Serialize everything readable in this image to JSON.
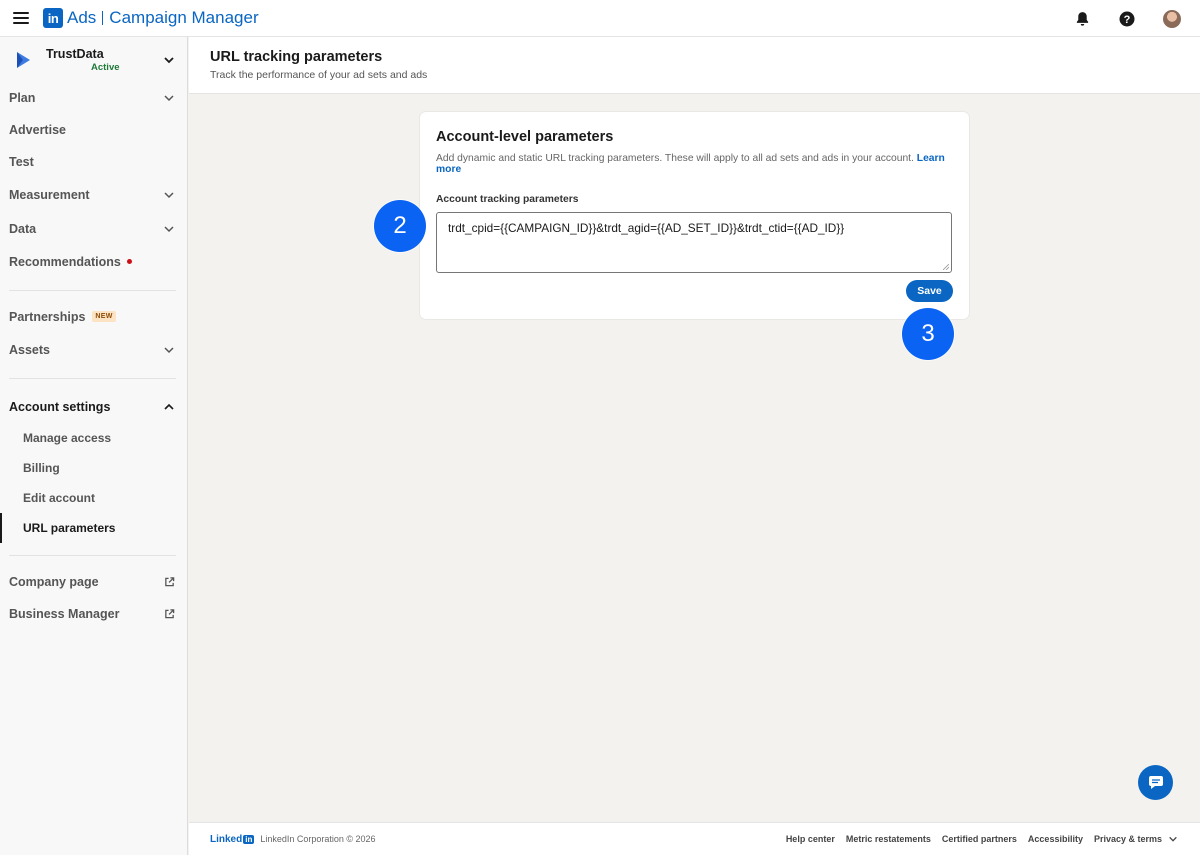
{
  "app": {
    "brand_ads": "Ads",
    "brand_product": "Campaign Manager",
    "logo_letters": "in"
  },
  "account": {
    "name": "TrustData",
    "status": "Active"
  },
  "sidebar": {
    "items": [
      {
        "label": "Plan"
      },
      {
        "label": "Advertise"
      },
      {
        "label": "Test"
      },
      {
        "label": "Measurement"
      },
      {
        "label": "Data"
      },
      {
        "label": "Recommendations"
      },
      {
        "label": "Partnerships",
        "badge": "NEW"
      },
      {
        "label": "Assets"
      },
      {
        "label": "Account settings"
      }
    ],
    "sub_items": [
      {
        "label": "Manage access"
      },
      {
        "label": "Billing"
      },
      {
        "label": "Edit account"
      },
      {
        "label": "URL parameters"
      }
    ],
    "external_items": [
      {
        "label": "Company page"
      },
      {
        "label": "Business Manager"
      }
    ]
  },
  "page": {
    "title": "URL tracking parameters",
    "subtitle": "Track the performance of your ad sets and ads"
  },
  "card": {
    "title": "Account-level parameters",
    "description": "Add dynamic and static URL tracking parameters. These will apply to all ad sets and ads in your account.",
    "learn_more": "Learn more",
    "field_label": "Account tracking parameters",
    "field_value": "trdt_cpid={{CAMPAIGN_ID}}&trdt_agid={{AD_SET_ID}}&trdt_ctid={{AD_ID}}",
    "save_label": "Save"
  },
  "steps": {
    "step_a": "2",
    "step_b": "3"
  },
  "footer": {
    "logo_text": "Linked",
    "logo_in": "in",
    "copyright": "LinkedIn Corporation © 2026",
    "links": [
      "Help center",
      "Metric restatements",
      "Certified partners",
      "Accessibility",
      "Privacy & terms"
    ]
  },
  "colors": {
    "brand_blue": "#0a66c2",
    "step_blue": "#0b63f3",
    "active_green": "#1f7a3a",
    "alert_red": "#cc1016"
  }
}
